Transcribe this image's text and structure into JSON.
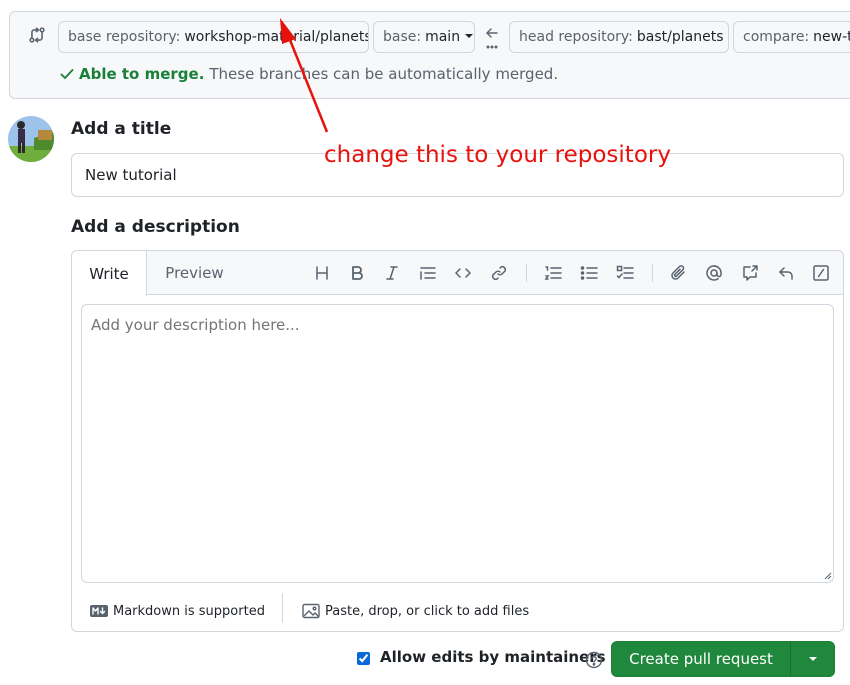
{
  "compare": {
    "base_repo_label": "base repository:",
    "base_repo_value": "workshop-material/planets",
    "base_label": "base:",
    "base_value": "main",
    "head_repo_label": "head repository:",
    "head_repo_value": "bast/planets",
    "compare_label": "compare:",
    "compare_value": "new-tu",
    "merge_status": "Able to merge.",
    "merge_detail": "These branches can be automatically merged."
  },
  "form": {
    "title_heading": "Add a title",
    "title_value": "New tutorial",
    "description_heading": "Add a description",
    "tabs": [
      "Write",
      "Preview"
    ],
    "description_placeholder": "Add your description here...",
    "markdown_note": "Markdown is supported",
    "attach_note": "Paste, drop, or click to add files"
  },
  "toolbar": {
    "icons": [
      "heading-icon",
      "bold-icon",
      "italic-icon",
      "quote-icon",
      "code-icon",
      "link-icon",
      "numbered-list-icon",
      "bulleted-list-icon",
      "task-list-icon",
      "attach-icon",
      "mention-icon",
      "cross-reference-icon",
      "reply-icon",
      "slash-command-icon"
    ]
  },
  "actions": {
    "allow_edits_label": "Allow edits by maintainers",
    "allow_edits_checked": true,
    "create_label": "Create pull request"
  },
  "annotation": {
    "text": "change this to your repository"
  },
  "colors": {
    "primary_green": "#1f883d",
    "success_text": "#1a7f37",
    "annotation_red": "#e8120c",
    "checkbox_blue": "#0969da"
  }
}
